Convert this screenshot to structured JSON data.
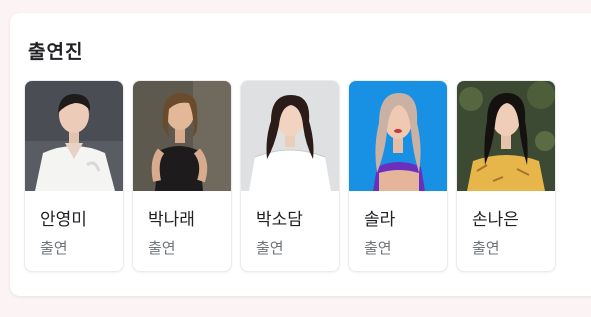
{
  "section": {
    "title": "출연진"
  },
  "cast": [
    {
      "name": "안영미",
      "role": "출연"
    },
    {
      "name": "박나래",
      "role": "출연"
    },
    {
      "name": "박소담",
      "role": "출연"
    },
    {
      "name": "솔라",
      "role": "출연"
    },
    {
      "name": "손나은",
      "role": "출연"
    }
  ]
}
